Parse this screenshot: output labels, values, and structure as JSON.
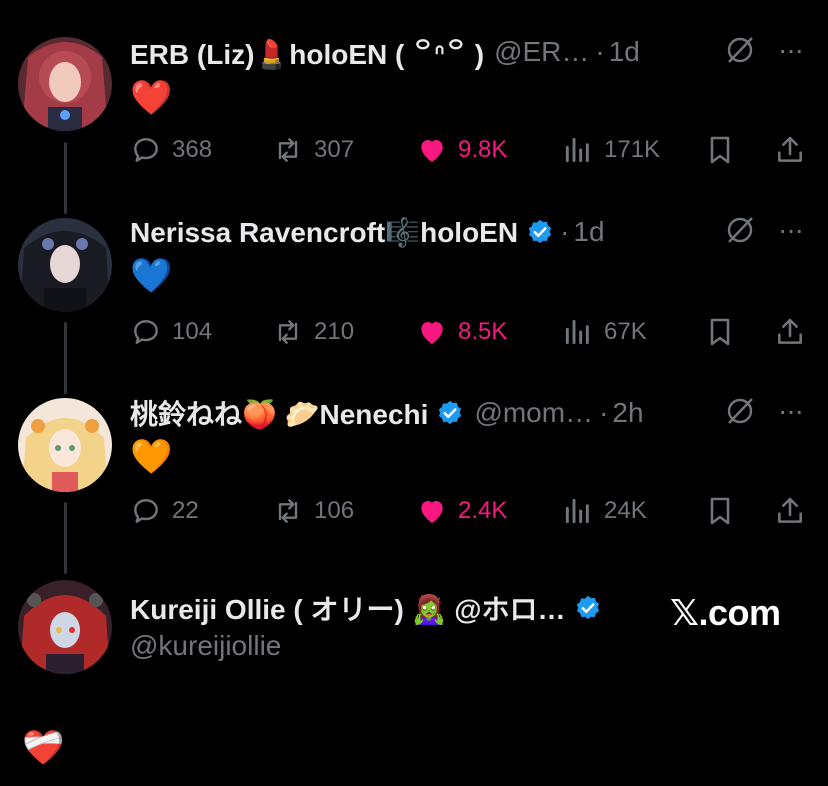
{
  "tweets": [
    {
      "name": "ERB (Liz)💄holoEN ( ꒪ᐢ꒪ )",
      "handle": "@ER…",
      "time": "1d",
      "verified": false,
      "body": "❤️",
      "replies": "368",
      "retweets": "307",
      "likes": "9.8K",
      "views": "171K"
    },
    {
      "name": "Nerissa Ravencroft🎼holoEN",
      "handle": "",
      "time": "1d",
      "verified": true,
      "body": "💙",
      "replies": "104",
      "retweets": "210",
      "likes": "8.5K",
      "views": "67K"
    },
    {
      "name": "桃鈴ねね🍑 🥟Nenechi",
      "handle": "@mom…",
      "time": "2h",
      "verified": true,
      "body": "🧡",
      "replies": "22",
      "retweets": "106",
      "likes": "2.4K",
      "views": "24K"
    },
    {
      "name": "Kureiji Ollie ( オリー) 🧟‍♀️ @ホロ…",
      "handle": "@kureijiollie",
      "verified": true,
      "body": "❤️‍🩹"
    }
  ],
  "icons": {
    "reply": "reply-icon",
    "retweet": "retweet-icon",
    "like": "heart-icon",
    "views": "views-icon",
    "bookmark": "bookmark-icon",
    "share": "share-icon",
    "grok": "grok-icon",
    "more": "more-icon"
  },
  "colors": {
    "background": "#000000",
    "muted": "#71767b",
    "like": "#f91880",
    "verified": "#1d9bf0"
  },
  "watermark": "𝕏.com"
}
